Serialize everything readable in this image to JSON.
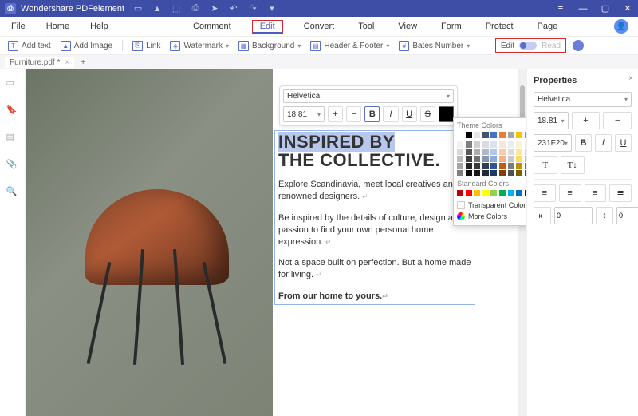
{
  "app": {
    "name": "Wondershare PDFelement"
  },
  "menu": {
    "file": "File",
    "home": "Home",
    "help": "Help",
    "comment": "Comment",
    "edit": "Edit",
    "convert": "Convert",
    "tool": "Tool",
    "view": "View",
    "form": "Form",
    "protect": "Protect",
    "page": "Page"
  },
  "toolbar": {
    "add_text": "Add text",
    "add_image": "Add Image",
    "link": "Link",
    "watermark": "Watermark",
    "background": "Background",
    "header_footer": "Header & Footer",
    "bates": "Bates Number",
    "edit": "Edit",
    "read": "Read"
  },
  "tab": {
    "filename": "Furniture.pdf *"
  },
  "float": {
    "font": "Helvetica",
    "size": "18.81",
    "plus": "+",
    "minus": "−",
    "b": "B",
    "i": "I",
    "u": "U",
    "s": "S"
  },
  "content": {
    "h1a": "INSPIRED BY",
    "h1b": "THE COLLECTIVE.",
    "p1": "Explore Scandinavia, meet local creatives and renowned designers.",
    "p2": "Be inspired by the details of culture, design and passion to find your own personal home expression.",
    "p3": "Not a space built on perfection. But a home made for living.",
    "p4": "From our home to yours."
  },
  "colorpopup": {
    "theme": "Theme Colors",
    "standard": "Standard Colors",
    "transparent": "Transparent Color",
    "more": "More Colors",
    "theme_colors": [
      "#ffffff",
      "#000000",
      "#e7e6e6",
      "#44546a",
      "#4472c4",
      "#ed7d31",
      "#a5a5a5",
      "#ffc000",
      "#5b9bd5",
      "#70ad47"
    ],
    "theme_tints": [
      [
        "#f2f2f2",
        "#7f7f7f",
        "#d0cece",
        "#d6dce4",
        "#d9e2f3",
        "#fbe5d5",
        "#ededed",
        "#fff2cc",
        "#deebf6",
        "#e2efd9"
      ],
      [
        "#d8d8d8",
        "#595959",
        "#aeabab",
        "#adb9ca",
        "#b4c6e7",
        "#f7cbac",
        "#dbdbdb",
        "#fee599",
        "#bdd7ee",
        "#c5e0b3"
      ],
      [
        "#bfbfbf",
        "#3f3f3f",
        "#757070",
        "#8496b0",
        "#8eaadb",
        "#f4b183",
        "#c9c9c9",
        "#ffd965",
        "#9cc3e5",
        "#a8d08d"
      ],
      [
        "#a5a5a5",
        "#262626",
        "#3a3838",
        "#323f4f",
        "#2f5496",
        "#c55a11",
        "#7b7b7b",
        "#bf9000",
        "#2e75b5",
        "#538135"
      ],
      [
        "#7f7f7f",
        "#0c0c0c",
        "#171616",
        "#222a35",
        "#1f3864",
        "#833c0b",
        "#525252",
        "#7f6000",
        "#1e4e79",
        "#375623"
      ]
    ],
    "standard_colors": [
      "#c00000",
      "#ff0000",
      "#ffc000",
      "#ffff00",
      "#92d050",
      "#00b050",
      "#00b0f0",
      "#0070c0",
      "#002060",
      "#7030a0"
    ]
  },
  "props": {
    "title": "Properties",
    "font": "Helvetica",
    "size": "18.81",
    "hex": "231F20",
    "b": "B",
    "i": "I",
    "u": "U",
    "indent": "0",
    "spacing": "0"
  }
}
